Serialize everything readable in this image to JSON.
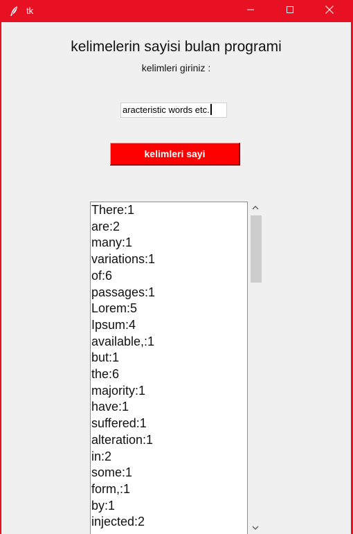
{
  "window": {
    "title": "tk",
    "icon": "feather-icon",
    "controls": {
      "minimize_icon": "minimize-icon",
      "maximize_icon": "maximize-icon",
      "close_icon": "close-icon"
    },
    "accent_color": "#e81123"
  },
  "main": {
    "heading": "kelimelerin sayisi bulan programi",
    "subheading": "kelimleri giriniz :",
    "input": {
      "value": "aracteristic words etc."
    },
    "count_button": {
      "label": "kelimleri sayi",
      "color": "#ff0000"
    },
    "results": {
      "items": [
        "There:1",
        "are:2",
        "many:1",
        "variations:1",
        "of:6",
        "passages:1",
        "Lorem:5",
        "Ipsum:4",
        "available,:1",
        "but:1",
        "the:6",
        "majority:1",
        "have:1",
        "suffered:1",
        "alteration:1",
        "in:2",
        "some:1",
        "form,:1",
        "by:1",
        "injected:2"
      ],
      "scrollbar": {
        "up_icon": "scroll-up-arrow-icon",
        "down_icon": "scroll-down-arrow-icon"
      }
    }
  }
}
